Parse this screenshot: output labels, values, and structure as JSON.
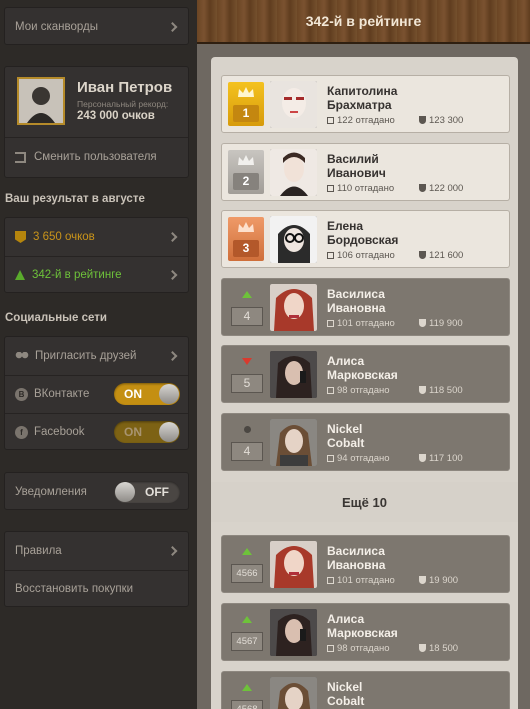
{
  "sidebar": {
    "my_crosswords": "Мои сканворды",
    "user": {
      "name": "Иван Петров",
      "record_label": "Персональный рекорд:",
      "record_value": "243 000 очков"
    },
    "switch_user": "Сменить пользователя",
    "month_title": "Ваш результат в августе",
    "points": "3 650 очков",
    "rating": "342-й в рейтинге",
    "social_title": "Социальные сети",
    "invite": "Пригласить друзей",
    "vk": {
      "label": "ВКонтакте",
      "state": "ON"
    },
    "facebook": {
      "label": "Facebook",
      "state": "ON"
    },
    "notifications": {
      "label": "Уведомления",
      "state": "OFF"
    },
    "rules": "Правила",
    "restore": "Восстановить покупки"
  },
  "header": {
    "title": "342-й в рейтинге"
  },
  "leaderboard": {
    "more_label": "Ещё 10",
    "entries": [
      {
        "first": "Капитолина",
        "last": "Брахматра",
        "solved": "122 отгадано",
        "score": "123 300",
        "rank": "1",
        "marker": "crown-gold"
      },
      {
        "first": "Василий",
        "last": "Иванович",
        "solved": "110 отгадано",
        "score": "122 000",
        "rank": "2",
        "marker": "crown-silver"
      },
      {
        "first": "Елена",
        "last": "Бордовская",
        "solved": "106 отгадано",
        "score": "121 600",
        "rank": "3",
        "marker": "crown-bronze"
      },
      {
        "first": "Василиса",
        "last": "Ивановна",
        "solved": "101 отгадано",
        "score": "119 900",
        "rank": "4",
        "marker": "arrow-up"
      },
      {
        "first": "Алиса",
        "last": "Марковская",
        "solved": "98 отгадано",
        "score": "118 500",
        "rank": "5",
        "marker": "arrow-down"
      },
      {
        "first": "Nickel",
        "last": "Cobalt",
        "solved": "94 отгадано",
        "score": "117 100",
        "rank": "4",
        "marker": "dot"
      },
      {
        "first": "Василиса",
        "last": "Ивановна",
        "solved": "101 отгадано",
        "score": "19 900",
        "rank": "4566",
        "marker": "arrow-up"
      },
      {
        "first": "Алиса",
        "last": "Марковская",
        "solved": "98 отгадано",
        "score": "18 500",
        "rank": "4567",
        "marker": "arrow-up"
      },
      {
        "first": "Nickel",
        "last": "Cobalt",
        "solved": "",
        "score": "",
        "rank": "4568",
        "marker": "arrow-up"
      }
    ]
  },
  "colors": {
    "accent": "#c48f12",
    "rank_up": "#6ec23a",
    "rank_down": "#d93a2e"
  }
}
